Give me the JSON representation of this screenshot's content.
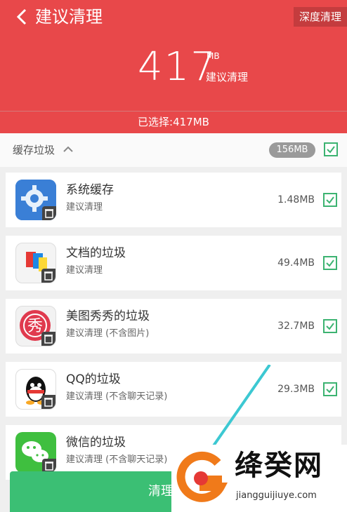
{
  "header": {
    "back_label": "建议清理",
    "deep_clean": "深度清理",
    "total_size": "417",
    "unit": "MB",
    "sub_label": "建议清理",
    "selected": "已选择:417MB"
  },
  "cache": {
    "label": "缓存垃圾",
    "badge": "156MB",
    "checked": true
  },
  "items": [
    {
      "name": "系统缓存",
      "sub": "建议清理",
      "size": "1.48MB",
      "icon": "gear-icon",
      "checked": true
    },
    {
      "name": "文档的垃圾",
      "sub": "建议清理",
      "size": "49.4MB",
      "icon": "docs-icon",
      "checked": true
    },
    {
      "name": "美图秀秀的垃圾",
      "sub": "建议清理 (不含图片)",
      "size": "32.7MB",
      "icon": "meitu-icon",
      "checked": true
    },
    {
      "name": "QQ的垃圾",
      "sub": "建议清理 (不含聊天记录)",
      "size": "29.3MB",
      "icon": "qq-icon",
      "checked": true
    },
    {
      "name": "微信的垃圾",
      "sub": "建议清理 (不含聊天记录)",
      "size": "",
      "icon": "wechat-icon",
      "checked": true
    }
  ],
  "clean_button": "清理垃圾",
  "watermark": {
    "name": "绛癸网",
    "url": "jiangguijiuye.com"
  },
  "colors": {
    "header": "#e8484a",
    "accent_green": "#3bbf74",
    "check_green": "#3cb371"
  }
}
